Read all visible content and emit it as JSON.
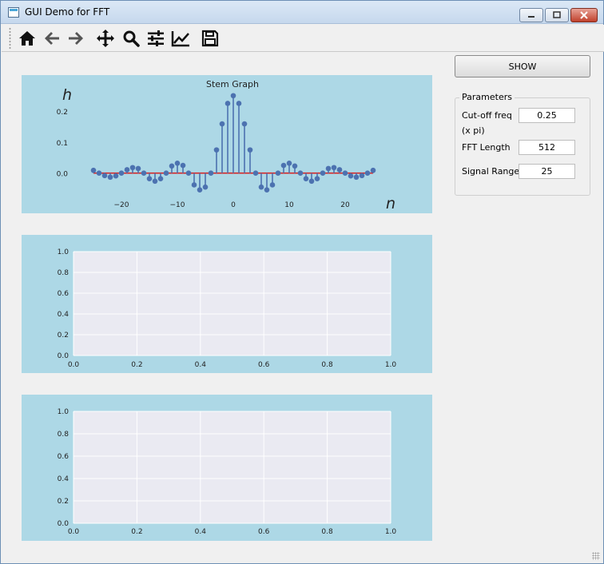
{
  "window": {
    "title": "GUI Demo for FFT"
  },
  "toolbar": {
    "icons": [
      "home-icon",
      "back-arrow-icon",
      "forward-arrow-icon",
      "pan-icon",
      "zoom-icon",
      "configure-subplots-icon",
      "axes-edit-icon",
      "save-icon"
    ]
  },
  "controls": {
    "show_label": "SHOW"
  },
  "parameters": {
    "title": "Parameters",
    "cutoff_label": "Cut-off freq",
    "cutoff_sub": "(x  pi)",
    "cutoff_value": "0.25",
    "fft_label": "FFT Length",
    "fft_value": "512",
    "range_label": "Signal Range",
    "range_value": "25"
  },
  "colors": {
    "panel_bg": "#add8e6",
    "plot_bg": "#eaeaf2",
    "stem": "#4c72b0",
    "baseline": "#d62728"
  },
  "chart_data": [
    {
      "type": "stem",
      "title": "Stem Graph",
      "xlabel": "n",
      "ylabel": "h",
      "xlim": [
        -26,
        26
      ],
      "ylim": [
        -0.06,
        0.27
      ],
      "xticks": [
        "−20",
        "−10",
        "0",
        "10",
        "20"
      ],
      "xtick_values": [
        -20,
        -10,
        0,
        10,
        20
      ],
      "yticks": [
        "0.0",
        "0.1",
        "0.2"
      ],
      "ytick_values": [
        0.0,
        0.1,
        0.2
      ],
      "x": [
        -25,
        -24,
        -23,
        -22,
        -21,
        -20,
        -19,
        -18,
        -17,
        -16,
        -15,
        -14,
        -13,
        -12,
        -11,
        -10,
        -9,
        -8,
        -7,
        -6,
        -5,
        -4,
        -3,
        -2,
        -1,
        0,
        1,
        2,
        3,
        4,
        5,
        6,
        7,
        8,
        9,
        10,
        11,
        12,
        13,
        14,
        15,
        16,
        17,
        18,
        19,
        20,
        21,
        22,
        23,
        24,
        25
      ],
      "y": [
        0.009,
        0.0,
        -0.008,
        -0.013,
        -0.009,
        0.0,
        0.011,
        0.018,
        0.015,
        0.0,
        -0.018,
        -0.026,
        -0.018,
        0.0,
        0.023,
        0.032,
        0.025,
        0.0,
        -0.038,
        -0.054,
        -0.045,
        0.0,
        0.075,
        0.159,
        0.225,
        0.25,
        0.225,
        0.159,
        0.075,
        0.0,
        -0.045,
        -0.054,
        -0.038,
        0.0,
        0.025,
        0.032,
        0.023,
        0.0,
        -0.018,
        -0.026,
        -0.018,
        0.0,
        0.015,
        0.018,
        0.011,
        0.0,
        -0.009,
        -0.013,
        -0.008,
        0.0,
        0.009
      ]
    },
    {
      "type": "line",
      "xlim": [
        0.0,
        1.0
      ],
      "ylim": [
        0.0,
        1.0
      ],
      "xticks": [
        "0.0",
        "0.2",
        "0.4",
        "0.6",
        "0.8",
        "1.0"
      ],
      "yticks": [
        "0.0",
        "0.2",
        "0.4",
        "0.6",
        "0.8",
        "1.0"
      ],
      "grid": true,
      "series": []
    },
    {
      "type": "line",
      "xlim": [
        0.0,
        1.0
      ],
      "ylim": [
        0.0,
        1.0
      ],
      "xticks": [
        "0.0",
        "0.2",
        "0.4",
        "0.6",
        "0.8",
        "1.0"
      ],
      "yticks": [
        "0.0",
        "0.2",
        "0.4",
        "0.6",
        "0.8",
        "1.0"
      ],
      "grid": true,
      "series": []
    }
  ]
}
